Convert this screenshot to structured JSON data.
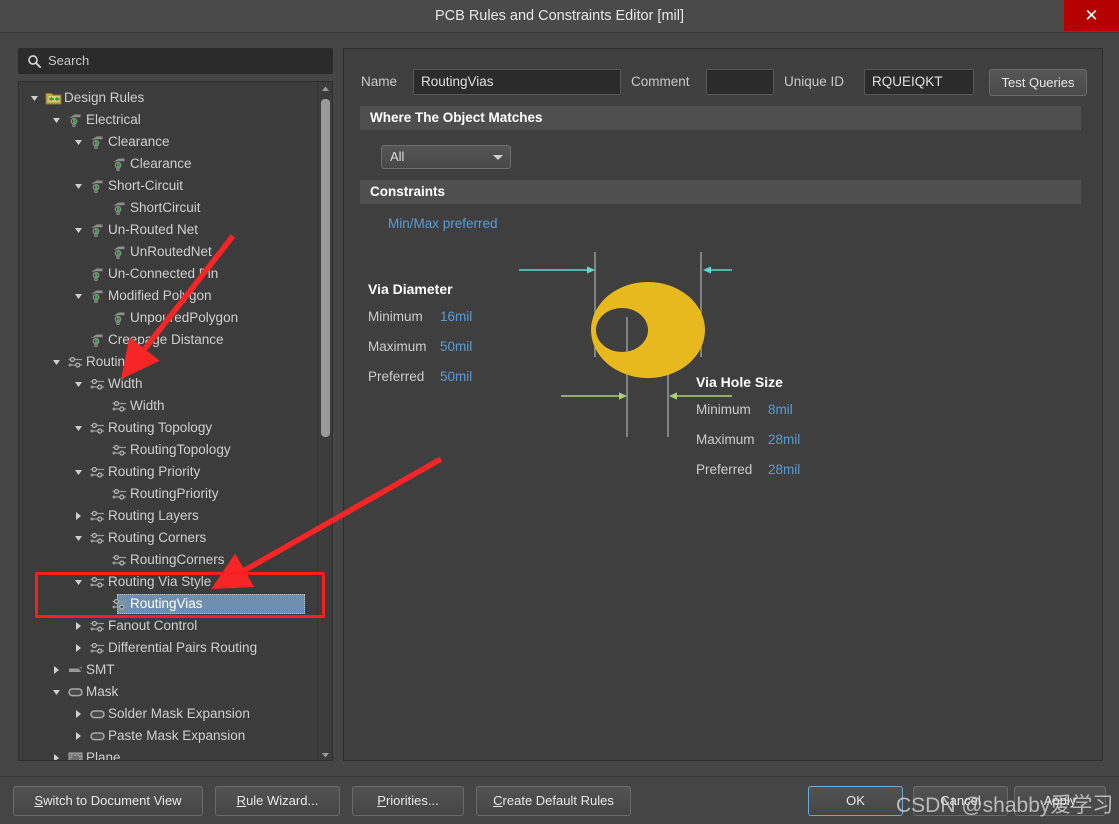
{
  "window": {
    "title": "PCB Rules and Constraints Editor [mil]",
    "close_label": "✕"
  },
  "search": {
    "placeholder": "Search",
    "icon": "search-icon"
  },
  "tree": {
    "items": [
      {
        "label": "Design Rules",
        "depth": 0,
        "expander": "down",
        "icon": "design-rules-folder-icon",
        "selected": false
      },
      {
        "label": "Electrical",
        "depth": 1,
        "expander": "down",
        "icon": "electrical-rule-icon",
        "selected": false
      },
      {
        "label": "Clearance",
        "depth": 2,
        "expander": "down",
        "icon": "electrical-rule-icon",
        "selected": false
      },
      {
        "label": "Clearance",
        "depth": 3,
        "expander": "none",
        "icon": "electrical-rule-icon",
        "selected": false
      },
      {
        "label": "Short-Circuit",
        "depth": 2,
        "expander": "down",
        "icon": "electrical-rule-icon",
        "selected": false
      },
      {
        "label": "ShortCircuit",
        "depth": 3,
        "expander": "none",
        "icon": "electrical-rule-icon",
        "selected": false
      },
      {
        "label": "Un-Routed Net",
        "depth": 2,
        "expander": "down",
        "icon": "electrical-rule-icon",
        "selected": false
      },
      {
        "label": "UnRoutedNet",
        "depth": 3,
        "expander": "none",
        "icon": "electrical-rule-icon",
        "selected": false
      },
      {
        "label": "Un-Connected Pin",
        "depth": 2,
        "expander": "none",
        "icon": "electrical-rule-icon",
        "selected": false
      },
      {
        "label": "Modified Polygon",
        "depth": 2,
        "expander": "down",
        "icon": "electrical-rule-icon",
        "selected": false
      },
      {
        "label": "UnpouredPolygon",
        "depth": 3,
        "expander": "none",
        "icon": "electrical-rule-icon",
        "selected": false
      },
      {
        "label": "Creepage Distance",
        "depth": 2,
        "expander": "none",
        "icon": "electrical-rule-icon",
        "selected": false
      },
      {
        "label": "Routing",
        "depth": 1,
        "expander": "down",
        "icon": "routing-rule-icon",
        "selected": false
      },
      {
        "label": "Width",
        "depth": 2,
        "expander": "down",
        "icon": "routing-rule-icon",
        "selected": false
      },
      {
        "label": "Width",
        "depth": 3,
        "expander": "none",
        "icon": "routing-rule-icon",
        "selected": false
      },
      {
        "label": "Routing Topology",
        "depth": 2,
        "expander": "down",
        "icon": "routing-rule-icon",
        "selected": false
      },
      {
        "label": "RoutingTopology",
        "depth": 3,
        "expander": "none",
        "icon": "routing-rule-icon",
        "selected": false
      },
      {
        "label": "Routing Priority",
        "depth": 2,
        "expander": "down",
        "icon": "routing-rule-icon",
        "selected": false
      },
      {
        "label": "RoutingPriority",
        "depth": 3,
        "expander": "none",
        "icon": "routing-rule-icon",
        "selected": false
      },
      {
        "label": "Routing Layers",
        "depth": 2,
        "expander": "right",
        "icon": "routing-rule-icon",
        "selected": false
      },
      {
        "label": "Routing Corners",
        "depth": 2,
        "expander": "down",
        "icon": "routing-rule-icon",
        "selected": false
      },
      {
        "label": "RoutingCorners",
        "depth": 3,
        "expander": "none",
        "icon": "routing-rule-icon",
        "selected": false
      },
      {
        "label": "Routing Via Style",
        "depth": 2,
        "expander": "down",
        "icon": "routing-rule-icon",
        "selected": false
      },
      {
        "label": "RoutingVias",
        "depth": 3,
        "expander": "none",
        "icon": "routing-rule-icon",
        "selected": true
      },
      {
        "label": "Fanout Control",
        "depth": 2,
        "expander": "right",
        "icon": "routing-rule-icon",
        "selected": false
      },
      {
        "label": "Differential Pairs Routing",
        "depth": 2,
        "expander": "right",
        "icon": "routing-rule-icon",
        "selected": false
      },
      {
        "label": "SMT",
        "depth": 1,
        "expander": "right",
        "icon": "smt-rule-icon",
        "selected": false
      },
      {
        "label": "Mask",
        "depth": 1,
        "expander": "down",
        "icon": "mask-rule-icon",
        "selected": false
      },
      {
        "label": "Solder Mask Expansion",
        "depth": 2,
        "expander": "right",
        "icon": "mask-rule-icon",
        "selected": false
      },
      {
        "label": "Paste Mask Expansion",
        "depth": 2,
        "expander": "right",
        "icon": "mask-rule-icon",
        "selected": false
      },
      {
        "label": "Plane",
        "depth": 1,
        "expander": "right",
        "icon": "plane-rule-icon",
        "selected": false
      }
    ]
  },
  "rule_header": {
    "name_label": "Name",
    "name_value": "RoutingVias",
    "comment_label": "Comment",
    "comment_value": "",
    "unique_id_label": "Unique ID",
    "unique_id_value": "RQUEIQKT",
    "test_queries_label": "Test Queries"
  },
  "where_section": {
    "title": "Where The Object Matches",
    "scope_value": "All"
  },
  "constraints_section": {
    "title": "Constraints",
    "mode_link": "Min/Max preferred",
    "via_diameter": {
      "title": "Via Diameter",
      "rows": [
        {
          "label": "Minimum",
          "value": "16mil"
        },
        {
          "label": "Maximum",
          "value": "50mil"
        },
        {
          "label": "Preferred",
          "value": "50mil"
        }
      ]
    },
    "via_hole_size": {
      "title": "Via Hole Size",
      "rows": [
        {
          "label": "Minimum",
          "value": "8mil"
        },
        {
          "label": "Maximum",
          "value": "28mil"
        },
        {
          "label": "Preferred",
          "value": "28mil"
        }
      ]
    },
    "diagram": {
      "pad_color": "#e8b81f",
      "diameter_arrow_color": "#5fd5cf",
      "hole_arrow_color": "#a8d17a"
    }
  },
  "footer": {
    "buttons": [
      {
        "label": "Switch to Document View",
        "accel": "S",
        "focused": false
      },
      {
        "label": "Rule Wizard...",
        "accel": "R",
        "focused": false
      },
      {
        "label": "Priorities...",
        "accel": "P",
        "focused": false
      },
      {
        "label": "Create Default Rules",
        "accel": "C",
        "focused": false
      }
    ],
    "ok_label": "OK",
    "cancel_label": "Cancel",
    "apply_label": "Apply"
  },
  "annotations": {
    "watermark": "CSDN @shabby爱学习",
    "arrow_color": "#f72525",
    "highlight_color": "#fc1f1f"
  }
}
